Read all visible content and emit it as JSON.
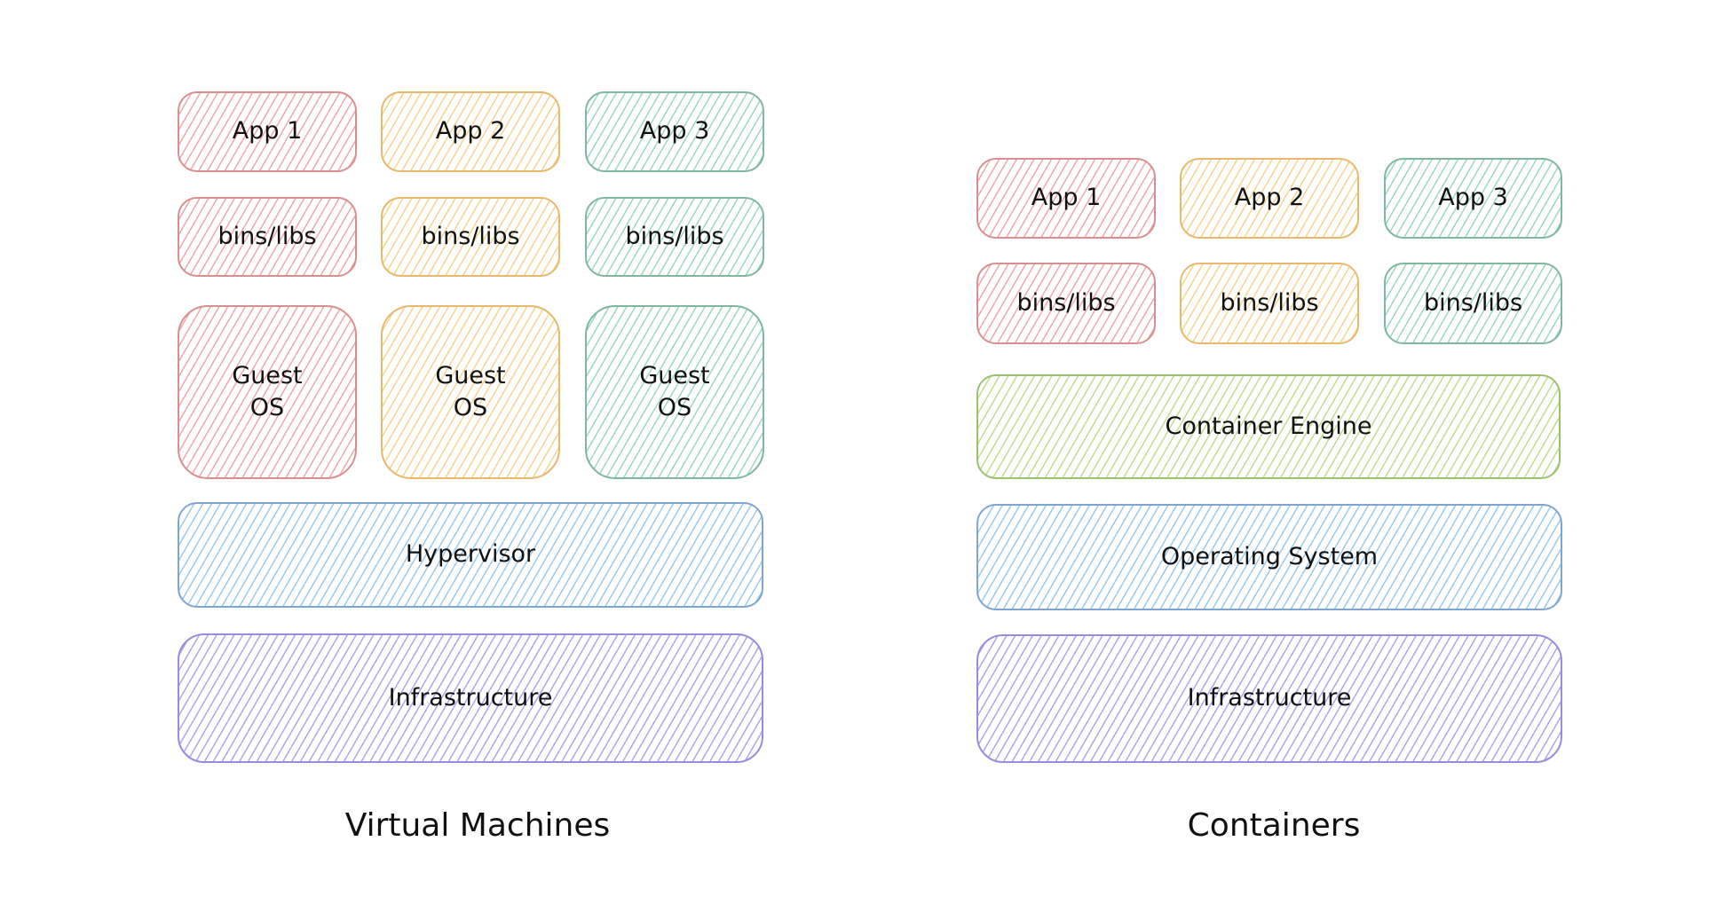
{
  "colors": {
    "red": "#d98f8f",
    "yellow": "#e8b86b",
    "green": "#7fb79f",
    "lime": "#9cc16e",
    "blue": "#7fa6d1",
    "purple": "#9a8ae0"
  },
  "vm": {
    "title": "Virtual Machines",
    "apps": [
      "App 1",
      "App 2",
      "App 3"
    ],
    "libs": [
      "bins/libs",
      "bins/libs",
      "bins/libs"
    ],
    "guest_os": [
      "Guest\nOS",
      "Guest\nOS",
      "Guest\nOS"
    ],
    "hypervisor": "Hypervisor",
    "infrastructure": "Infrastructure"
  },
  "containers": {
    "title": "Containers",
    "apps": [
      "App 1",
      "App 2",
      "App 3"
    ],
    "libs": [
      "bins/libs",
      "bins/libs",
      "bins/libs"
    ],
    "engine": "Container Engine",
    "os": "Operating System",
    "infrastructure": "Infrastructure"
  }
}
